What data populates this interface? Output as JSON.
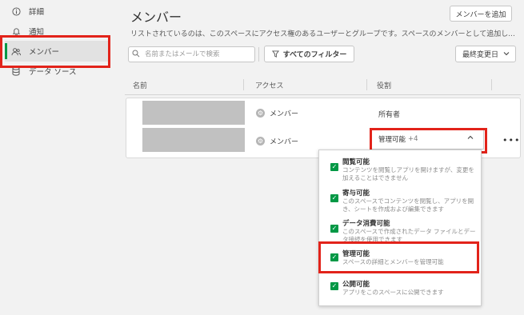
{
  "sidebar": {
    "items": [
      {
        "label": "詳細",
        "icon": "info-icon"
      },
      {
        "label": "通知",
        "icon": "bell-icon"
      },
      {
        "label": "メンバー",
        "icon": "members-icon"
      },
      {
        "label": "データ ソース",
        "icon": "database-icon"
      }
    ]
  },
  "header": {
    "title": "メンバー",
    "add_button": "メンバーを追加",
    "description": "リストされているのは、このスペースにアクセス権のあるユーザーとグループです。スペースのメンバーとして追加し..."
  },
  "toolbar": {
    "search_placeholder": "名前またはメールで検索",
    "filter_button": "すべてのフィルター",
    "sort_label": "最終変更日"
  },
  "table": {
    "columns": [
      "名前",
      "アクセス",
      "役割"
    ],
    "rows": [
      {
        "access": "メンバー",
        "role": "所有者"
      },
      {
        "access": "メンバー",
        "role": "管理可能",
        "role_extra": "+4"
      }
    ]
  },
  "dropdown": {
    "options": [
      {
        "title": "閲覧可能",
        "desc": "コンテンツを閲覧しアプリを開けますが、変更を加えることはできません",
        "checked": true
      },
      {
        "title": "寄与可能",
        "desc": "このスペースでコンテンツを閲覧し、アプリを開き、シートを作成および編集できます",
        "checked": true
      },
      {
        "title": "データ消費可能",
        "desc": "このスペースで作成されたデータ ファイルとデータ接続を使用できます",
        "checked": true
      },
      {
        "title": "管理可能",
        "desc": "スペースの詳細とメンバーを管理可能",
        "checked": true
      },
      {
        "title": "公開可能",
        "desc": "アプリをこのスペースに公開できます",
        "checked": true
      }
    ]
  },
  "colors": {
    "accent_green": "#009845",
    "highlight_red": "#e2231a"
  }
}
